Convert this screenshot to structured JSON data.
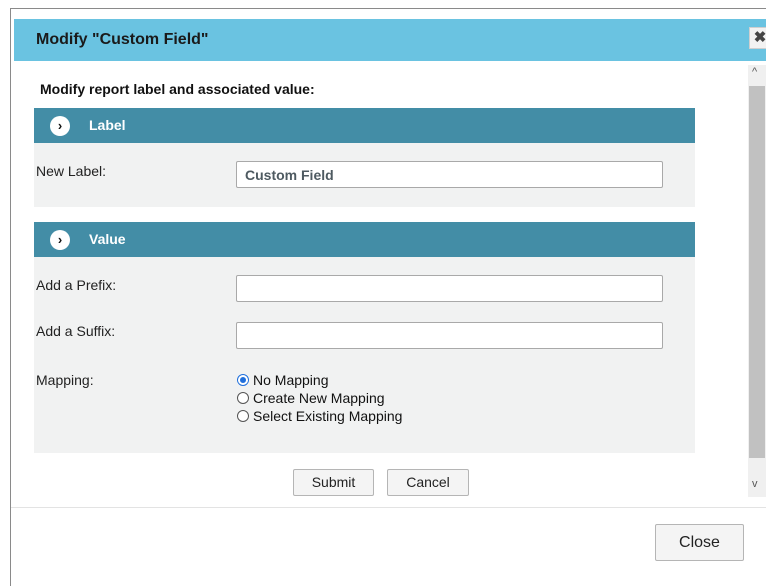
{
  "dialog": {
    "title": "Modify \"Custom Field\"",
    "close_x": "✖",
    "intro": "Modify report label and associated value:",
    "colors": {
      "title_bar": "#6ac3e1",
      "section_header": "#438da6",
      "section_body": "#f1f2f2",
      "radio_accent": "#1f6fdc"
    }
  },
  "label_section": {
    "header": "Label",
    "icon": "chevron-right-circle-icon",
    "new_label": {
      "label": "New Label:",
      "value": "Custom Field"
    }
  },
  "value_section": {
    "header": "Value",
    "icon": "chevron-right-circle-icon",
    "prefix": {
      "label": "Add a Prefix:",
      "value": ""
    },
    "suffix": {
      "label": "Add a Suffix:",
      "value": ""
    },
    "mapping": {
      "label": "Mapping:",
      "options": [
        {
          "label": "No Mapping",
          "checked": true
        },
        {
          "label": "Create New Mapping",
          "checked": false
        },
        {
          "label": "Select Existing Mapping",
          "checked": false
        }
      ]
    }
  },
  "actions": {
    "submit": "Submit",
    "cancel": "Cancel"
  },
  "footer": {
    "close": "Close"
  },
  "scrollbar": {
    "up_arrow": "^",
    "down_arrow": "v"
  }
}
